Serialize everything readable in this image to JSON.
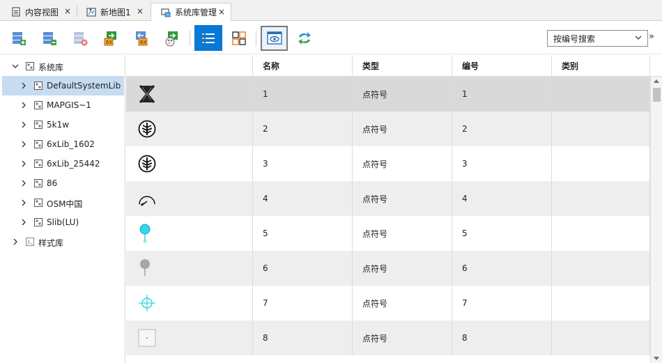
{
  "tabs": [
    {
      "label": "内容视图",
      "icon": "document-icon",
      "close": "×"
    },
    {
      "label": "新地图1",
      "icon": "map-icon",
      "close": "×"
    },
    {
      "label": "系统库管理",
      "icon": "library-manager-icon",
      "close": "×",
      "active": true
    }
  ],
  "toolbar": {
    "buttons": [
      {
        "name": "add-library-icon"
      },
      {
        "name": "remove-library-icon"
      },
      {
        "name": "delete-library-icon"
      },
      {
        "name": "import-6x-icon"
      },
      {
        "name": "export-6x-icon"
      },
      {
        "name": "style-library-icon"
      },
      {
        "name": "list-view-icon"
      },
      {
        "name": "grid-view-icon"
      },
      {
        "name": "preview-icon"
      },
      {
        "name": "refresh-icon"
      }
    ],
    "search_mode": "按编号搜索",
    "overflow": "»"
  },
  "tree": {
    "root": {
      "label": "系统库",
      "expanded": true
    },
    "children": [
      {
        "label": "DefaultSystemLib",
        "selected": true
      },
      {
        "label": "MAPGIS~1"
      },
      {
        "label": "5k1w"
      },
      {
        "label": "6xLib_1602"
      },
      {
        "label": "6xLib_25442"
      },
      {
        "label": "86"
      },
      {
        "label": "OSM中国"
      },
      {
        "label": "Slib(LU)"
      }
    ],
    "style_root": {
      "label": "样式库",
      "expanded": false
    }
  },
  "grid": {
    "columns": [
      "",
      "名称",
      "类型",
      "编号",
      "类别"
    ],
    "rows": [
      {
        "symbol": "hourglass-x-symbol",
        "name": "1",
        "type": "点符号",
        "id": "1",
        "category": ""
      },
      {
        "symbol": "circled-tree-symbol",
        "name": "2",
        "type": "点符号",
        "id": "2",
        "category": ""
      },
      {
        "symbol": "circled-tree-symbol-alt",
        "name": "3",
        "type": "点符号",
        "id": "3",
        "category": ""
      },
      {
        "symbol": "gauge-symbol",
        "name": "4",
        "type": "点符号",
        "id": "4",
        "category": ""
      },
      {
        "symbol": "cyan-pin-symbol",
        "name": "5",
        "type": "点符号",
        "id": "5",
        "category": ""
      },
      {
        "symbol": "gray-pin-symbol",
        "name": "6",
        "type": "点符号",
        "id": "6",
        "category": ""
      },
      {
        "symbol": "crosshair-symbol",
        "name": "7",
        "type": "点符号",
        "id": "7",
        "category": ""
      },
      {
        "symbol": "small-square-symbol",
        "name": "8",
        "type": "点符号",
        "id": "8",
        "category": ""
      }
    ]
  },
  "colors": {
    "accent_blue": "#0a78d7",
    "tree_selection": "#c6dcf3",
    "row_selection": "#d9d9d9",
    "row_alt": "#eeeeee",
    "symbol_cyan": "#3ad4e8"
  }
}
